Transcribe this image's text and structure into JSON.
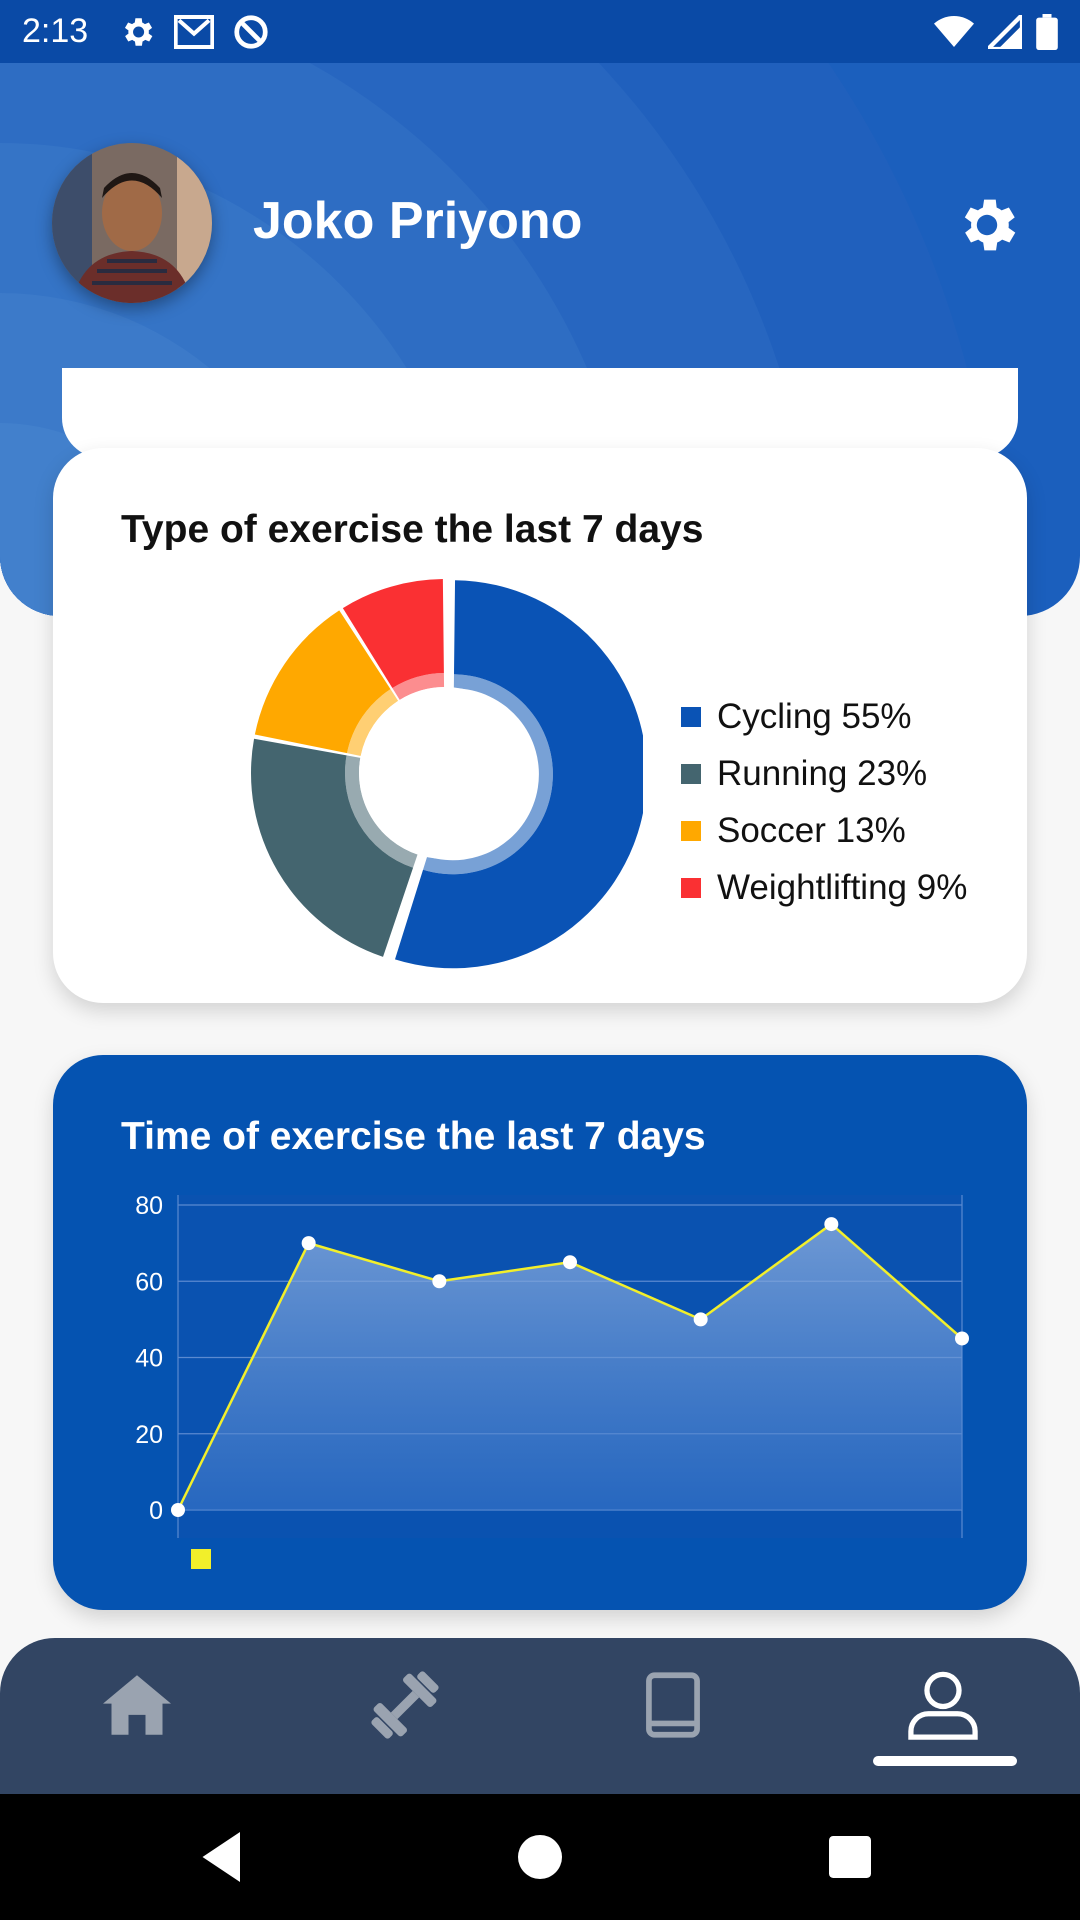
{
  "status_bar": {
    "time": "2:13",
    "icons_left": [
      "settings-icon",
      "gmail-icon",
      "sync-icon"
    ],
    "icons_right": [
      "wifi-icon",
      "signal-icon",
      "battery-icon"
    ]
  },
  "header": {
    "user_name": "Joko Priyono",
    "settings_icon": "gear-icon"
  },
  "exercise_type_card": {
    "title": "Type of exercise the last 7 days",
    "legend": [
      {
        "label": "Cycling 55%",
        "color": "#0a53b5"
      },
      {
        "label": "Running 23%",
        "color": "#44656f"
      },
      {
        "label": "Soccer 13%",
        "color": "#ffa800"
      },
      {
        "label": "Weightlifting 9%",
        "color": "#fa3033"
      }
    ]
  },
  "exercise_time_card": {
    "title": "Time of exercise the last 7 days"
  },
  "chart_data": [
    {
      "type": "pie",
      "title": "Type of exercise the last 7 days",
      "categories": [
        "Cycling",
        "Running",
        "Soccer",
        "Weightlifting"
      ],
      "values": [
        55,
        23,
        13,
        9
      ],
      "colors": [
        "#0a53b5",
        "#44656f",
        "#ffa800",
        "#fa3033"
      ],
      "legend": "right"
    },
    {
      "type": "area",
      "title": "Time of exercise the last 7 days",
      "x": [
        1,
        2,
        3,
        4,
        5,
        6,
        7
      ],
      "series": [
        {
          "values": [
            0,
            70,
            60,
            65,
            50,
            75,
            45
          ],
          "color": "#f2ef2a"
        }
      ],
      "ylim": [
        0,
        80
      ],
      "yticks": [
        0,
        20,
        40,
        60,
        80
      ],
      "grid": true,
      "legend": "bottom-left"
    }
  ],
  "bottom_nav": {
    "items": [
      "home-icon",
      "dumbbell-icon",
      "book-icon",
      "profile-icon"
    ],
    "active_index": 3
  },
  "system_nav": {
    "items": [
      "back-icon",
      "home-circle-icon",
      "recents-icon"
    ]
  }
}
